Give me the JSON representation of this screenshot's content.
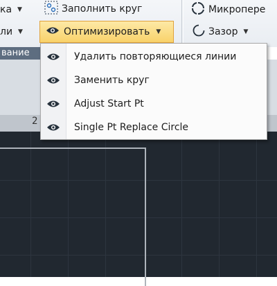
{
  "ribbon": {
    "tl_label": "ка",
    "ml_label": "ли",
    "fill_circle_label": "Заполнить круг",
    "optimize_label": "Оптимизировать",
    "micro_label": "Микропере",
    "gap_label": "Зазор",
    "panel_label": "вание"
  },
  "ruler": {
    "number": "2"
  },
  "menu": {
    "items": [
      {
        "label": "Удалить повторяющиеся линии",
        "icon": "eye-icon"
      },
      {
        "label": "Заменить круг",
        "icon": "eye-icon"
      },
      {
        "label": "Adjust Start Pt",
        "icon": "eye-icon"
      },
      {
        "label": "Single Pt Replace Circle",
        "icon": "eye-icon"
      }
    ]
  },
  "colors": {
    "canvas": "#212830",
    "highlight": "#f9d26a",
    "panel_bar": "#5d6d80"
  }
}
